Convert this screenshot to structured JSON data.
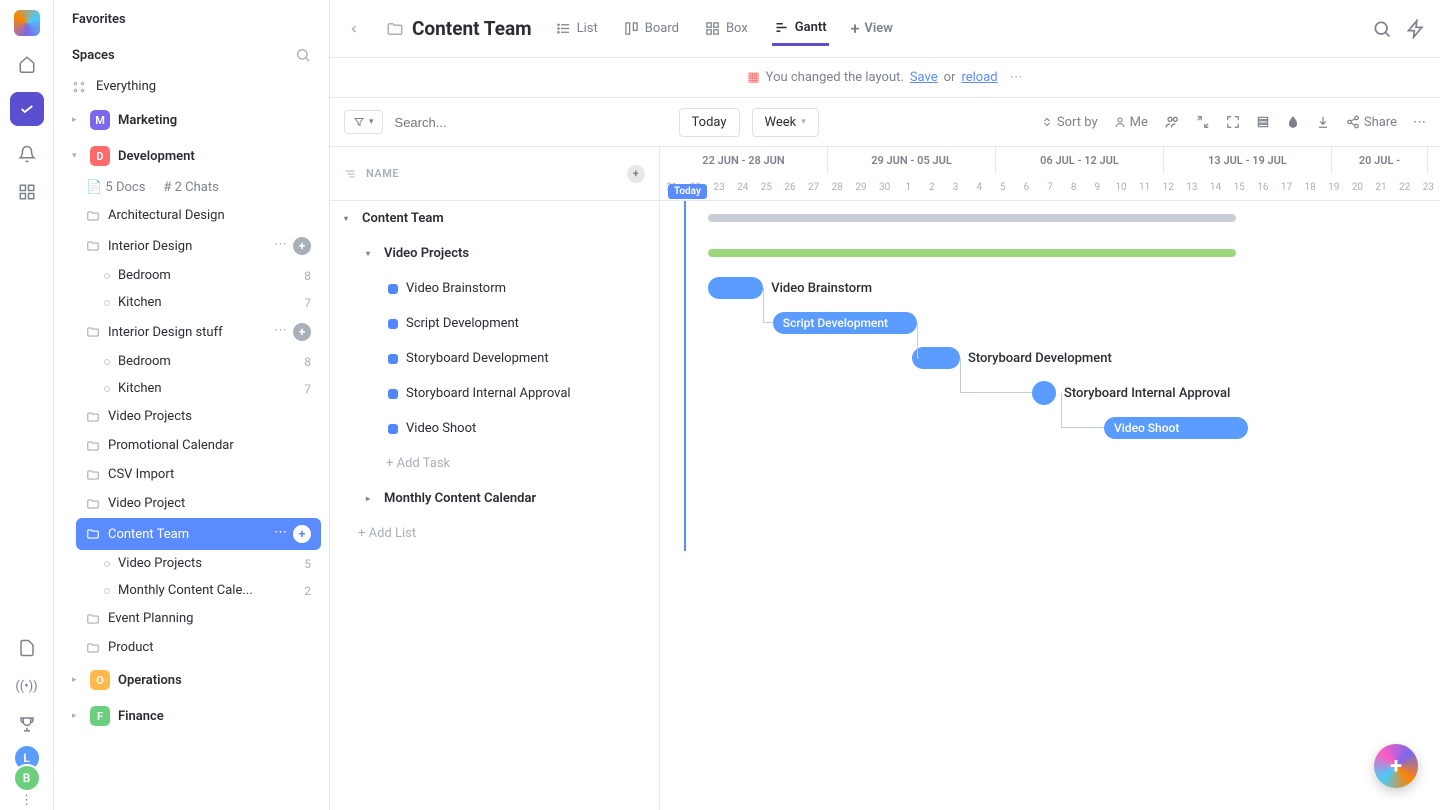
{
  "sidebar": {
    "favorites": "Favorites",
    "spaces": "Spaces",
    "everything": "Everything",
    "tree": [
      {
        "type": "space",
        "key": "marketing",
        "name": "Marketing",
        "badge": "M",
        "color": "#7b68ee",
        "open": false
      },
      {
        "type": "space",
        "key": "development",
        "name": "Development",
        "badge": "D",
        "color": "#ff6b6b",
        "open": true,
        "children": [
          {
            "type": "meta",
            "docs": "5 Docs",
            "chats": "2 Chats"
          },
          {
            "type": "folder",
            "name": "Architectural Design"
          },
          {
            "type": "folder",
            "name": "Interior Design",
            "actions": true,
            "children": [
              {
                "type": "list",
                "name": "Bedroom",
                "count": 8
              },
              {
                "type": "list",
                "name": "Kitchen",
                "count": 7
              }
            ]
          },
          {
            "type": "folder",
            "name": "Interior Design stuff",
            "actions": true,
            "children": [
              {
                "type": "list",
                "name": "Bedroom",
                "count": 8
              },
              {
                "type": "list",
                "name": "Kitchen",
                "count": 7
              }
            ]
          },
          {
            "type": "folder",
            "name": "Video Projects"
          },
          {
            "type": "folder",
            "name": "Promotional Calendar"
          },
          {
            "type": "folder",
            "name": "CSV Import"
          },
          {
            "type": "folder",
            "name": "Video Project"
          },
          {
            "type": "folder",
            "name": "Content Team",
            "selected": true,
            "actions": true,
            "children": [
              {
                "type": "list",
                "name": "Video Projects",
                "count": 5
              },
              {
                "type": "list",
                "name": "Monthly Content Cale...",
                "count": 2
              }
            ]
          },
          {
            "type": "folder",
            "name": "Event Planning"
          },
          {
            "type": "folder",
            "name": "Product"
          }
        ]
      },
      {
        "type": "space",
        "key": "operations",
        "name": "Operations",
        "badge": "O",
        "color": "#ffb84d",
        "open": false
      },
      {
        "type": "space",
        "key": "finance",
        "name": "Finance",
        "badge": "F",
        "color": "#6bcf7e",
        "open": false
      }
    ]
  },
  "topbar": {
    "title": "Content Team",
    "views": {
      "list": "List",
      "board": "Board",
      "box": "Box",
      "gantt": "Gantt"
    },
    "add_view": "View"
  },
  "layoutbar": {
    "msg": "You changed the layout.",
    "save": "Save",
    "or": "or",
    "reload": "reload"
  },
  "toolbar": {
    "search_ph": "Search...",
    "today": "Today",
    "week": "Week",
    "sort": "Sort by",
    "me": "Me",
    "share": "Share"
  },
  "gantt": {
    "name_hdr": "NAME",
    "weeks": [
      {
        "label": "22 JUN - 28 JUN",
        "days": 7
      },
      {
        "label": "29 JUN - 05 JUL",
        "days": 7
      },
      {
        "label": "06 JUL - 12 JUL",
        "days": 7
      },
      {
        "label": "13 JUL - 19 JUL",
        "days": 7
      },
      {
        "label": "20 JUL -",
        "days": 4
      }
    ],
    "days": [
      "21",
      "22",
      "23",
      "24",
      "25",
      "26",
      "27",
      "28",
      "29",
      "30",
      "1",
      "2",
      "3",
      "4",
      "5",
      "6",
      "7",
      "8",
      "9",
      "10",
      "11",
      "12",
      "13",
      "14",
      "15",
      "16",
      "17",
      "18",
      "19",
      "20",
      "21",
      "22",
      "23"
    ],
    "today": "Today",
    "rows": [
      {
        "type": "group",
        "name": "Content Team",
        "level": 0,
        "bar": {
          "start": 2,
          "span": 22,
          "color": "#c7cdd4",
          "thin": true
        }
      },
      {
        "type": "group",
        "name": "Video Projects",
        "level": 1,
        "bar": {
          "start": 2,
          "span": 22,
          "color": "#9dd67d",
          "thin": true
        }
      },
      {
        "type": "task",
        "name": "Video Brainstorm",
        "level": 2,
        "bar": {
          "start": 2,
          "span": 2.3,
          "color": "#5a9cff",
          "label_side": "right"
        }
      },
      {
        "type": "task",
        "name": "Script Development",
        "level": 2,
        "bar": {
          "start": 4.7,
          "span": 6,
          "color": "#5a9cff",
          "text_inside": true
        }
      },
      {
        "type": "task",
        "name": "Storyboard Development",
        "level": 2,
        "bar": {
          "start": 10.5,
          "span": 2,
          "color": "#5a9cff",
          "label_side": "right"
        }
      },
      {
        "type": "task",
        "name": "Storyboard Internal Approval",
        "level": 2,
        "bar": {
          "start": 15.5,
          "span": 1.2,
          "color": "#5a9cff",
          "circle": true,
          "label_side": "right"
        }
      },
      {
        "type": "task",
        "name": "Video Shoot",
        "level": 2,
        "bar": {
          "start": 18.5,
          "span": 6,
          "color": "#5a9cff",
          "text_inside": true
        }
      },
      {
        "type": "add",
        "name": "+ Add Task",
        "level": 2
      },
      {
        "type": "group",
        "name": "Monthly Content Calendar",
        "level": 1,
        "collapsed": true
      },
      {
        "type": "add_list",
        "name": "+ Add List"
      }
    ]
  }
}
